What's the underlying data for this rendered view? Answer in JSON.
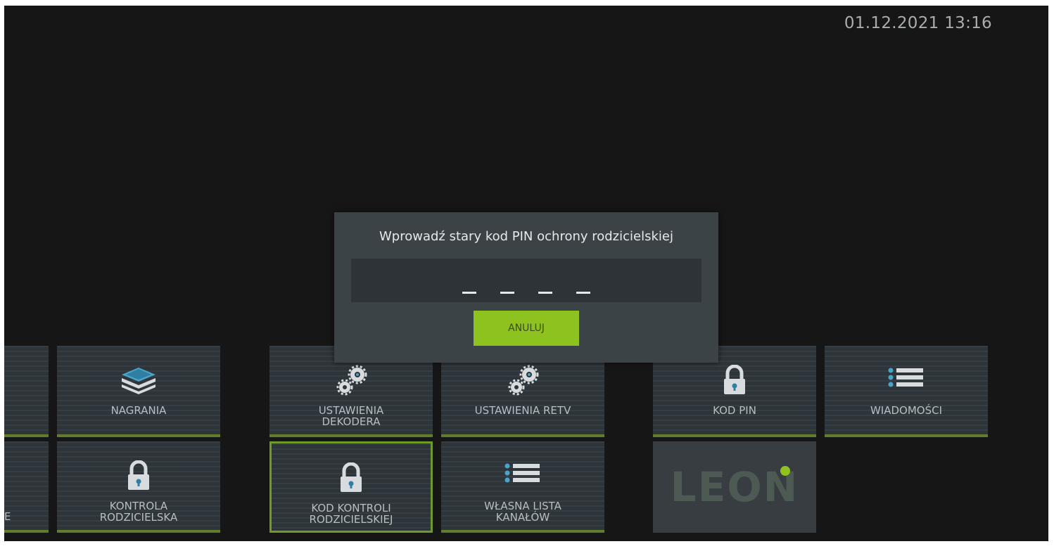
{
  "clock": "01.12.2021 13:16",
  "dialog": {
    "title": "Wprowadź stary kod PIN ochrony rodzicielskiej",
    "pin_slots": 4,
    "cancel_label": "ANULUJ"
  },
  "tiles": {
    "nagrania": "NAGRANIA",
    "ustawienia_dekodera_1": "USTAWIENIA",
    "ustawienia_dekodera_2": "DEKODERA",
    "ustawienia_retv": "USTAWIENIA RETV",
    "kod_pin": "KOD PIN",
    "wiadomosci": "WIADOMOŚCI",
    "kontrola_1": "KONTROLA",
    "kontrola_2": "RODZICIELSKA",
    "kod_kontroli_1": "KOD KONTROLI",
    "kod_kontroli_2": "RODZICIELSKIEJ",
    "lista_1": "WŁASNA LISTA",
    "lista_2": "KANAŁÓW",
    "partial_edge": "E"
  },
  "logo": "LEON",
  "colors": {
    "accent_green": "#8dc21f",
    "tile_underline": "#5f7d2c",
    "background": "#161616"
  }
}
